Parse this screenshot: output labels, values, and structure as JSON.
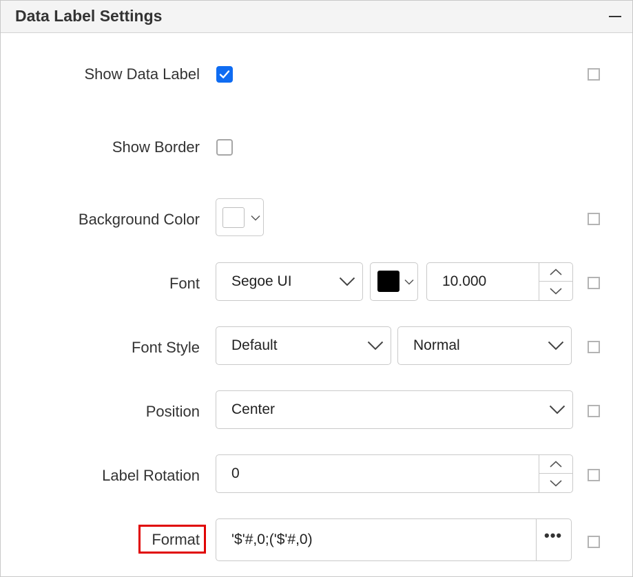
{
  "panel": {
    "title": "Data Label Settings"
  },
  "show_data_label": {
    "label": "Show Data Label",
    "checked": true
  },
  "show_border": {
    "label": "Show Border",
    "checked": false
  },
  "background_color": {
    "label": "Background Color",
    "swatch_color": "#ffffff"
  },
  "font": {
    "label": "Font",
    "family": "Segoe UI",
    "color": "#000000",
    "size": "10.000"
  },
  "font_style": {
    "label": "Font Style",
    "style": "Default",
    "weight": "Normal"
  },
  "position": {
    "label": "Position",
    "value": "Center"
  },
  "label_rotation": {
    "label": "Label Rotation",
    "value": "0"
  },
  "format": {
    "label": "Format",
    "value": "'$'#,0;('$'#,0)"
  },
  "colors": {
    "accent": "#0f6cf2",
    "highlight_border": "#e00000",
    "header_bg": "#f4f4f4"
  }
}
